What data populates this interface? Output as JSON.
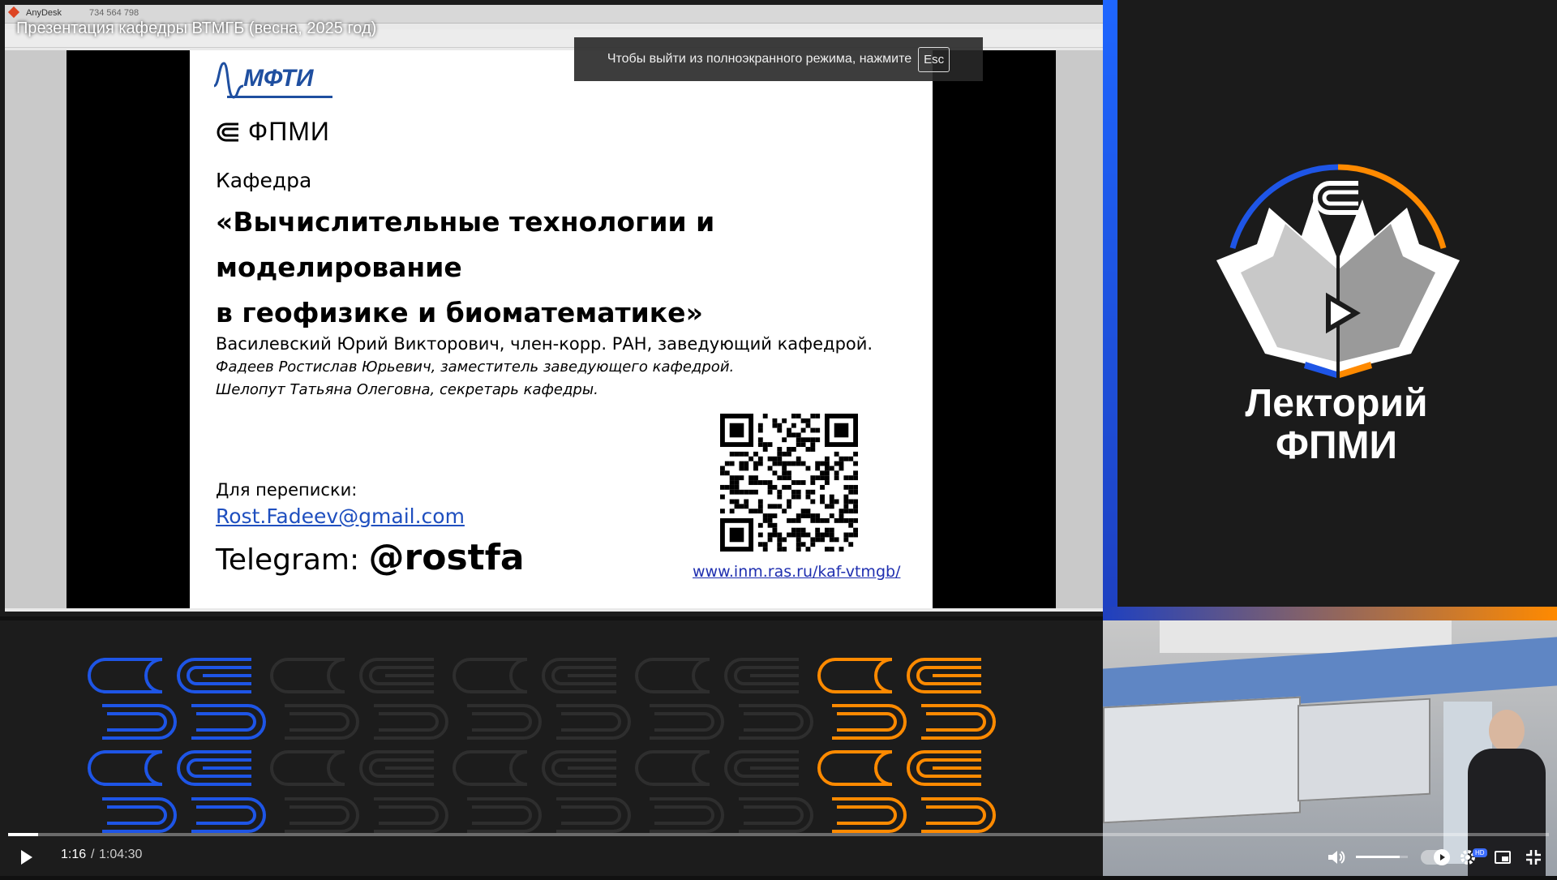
{
  "video": {
    "title": "Презентация кафедры ВТМГБ (весна, 2025 год)",
    "fullscreen_hint": "Чтобы выйти из полноэкранного режима, нажмите",
    "esc_key": "Esc",
    "time_current": "1:16",
    "time_separator": "/",
    "time_total": "1:04:30",
    "progress": 0.0196,
    "volume": 0.85,
    "quality_badge": "HD"
  },
  "anydesk": {
    "app_name": "AnyDesk",
    "session_id": "734 564 798"
  },
  "slide": {
    "mipt_logo": "МФТИ",
    "fpmi_logo": "ФПМИ",
    "kafedra_label": "Кафедра",
    "dept_title_line1": "«Вычислительные технологии и моделирование",
    "dept_title_line2": "в геофизике и биоматематике»",
    "head": "Василевский Юрий Викторович, член-корр. РАН, заведующий кафедрой.",
    "deputy": "Фадеев Ростислав Юрьевич, заместитель заведующего кафедрой.",
    "secretary": "Шелопут Татьяна Олеговна, секретарь кафедры.",
    "contact_label": "Для переписки:",
    "email": "Rost.Fadeev@gmail.com",
    "telegram_label": "Telegram:",
    "telegram_handle": "@rostfa",
    "site": "www.inm.ras.ru/kaf-vtmgb/"
  },
  "brand": {
    "name_line1": "Лекторий",
    "name_line2": "ФПМИ",
    "color_blue": "#1e55e6",
    "color_orange": "#ff8a00"
  },
  "icons": {
    "play": "play-icon",
    "volume": "volume-icon",
    "settings": "gear-icon",
    "miniplayer": "miniplayer-icon",
    "exit_fullscreen": "exit-fullscreen-icon"
  }
}
